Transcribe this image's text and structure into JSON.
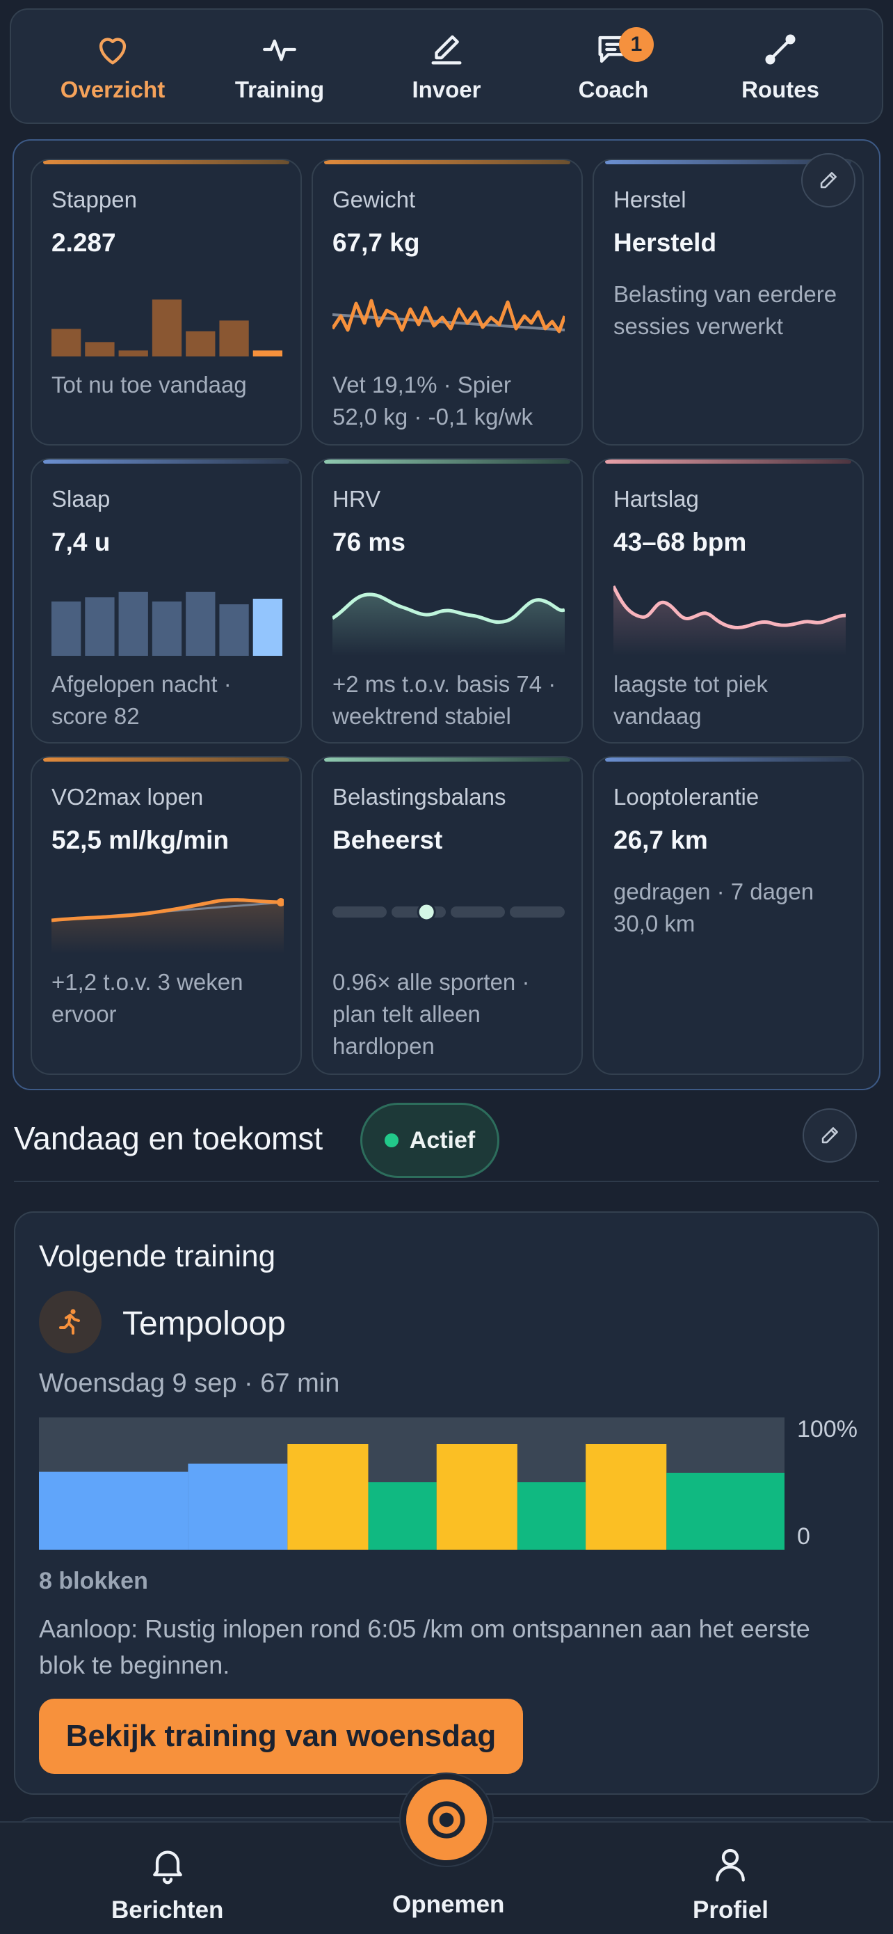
{
  "nav": {
    "items": [
      {
        "label": "Overzicht",
        "icon": "heart-icon",
        "active": true
      },
      {
        "label": "Training",
        "icon": "activity-icon",
        "active": false
      },
      {
        "label": "Invoer",
        "icon": "pencil-icon",
        "active": false
      },
      {
        "label": "Coach",
        "icon": "chat-icon",
        "active": false,
        "badge": "1"
      },
      {
        "label": "Routes",
        "icon": "route-icon",
        "active": false
      }
    ]
  },
  "metrics": [
    {
      "title": "Stappen",
      "value": "2.287",
      "desc": "Tot nu toe vandaag",
      "accent": "#e08a3c"
    },
    {
      "title": "Gewicht",
      "value": "67,7 kg",
      "desc": "Vet 19,1% · Spier 52,0 kg · -0,1 kg/wk",
      "accent": "#e08a3c"
    },
    {
      "title": "Herstel",
      "value": "Hersteld",
      "desc": "Belasting van eerdere sessies verwerkt",
      "accent": "#6b8fd0"
    },
    {
      "title": "Slaap",
      "value": "7,4 u",
      "desc": "Afgelopen nacht · score 82",
      "accent": "#6b8fd0"
    },
    {
      "title": "HRV",
      "value": "76 ms",
      "desc": "+2 ms t.o.v. basis 74 · weektrend stabiel",
      "accent": "#8fc9b0"
    },
    {
      "title": "Hartslag",
      "value": "43–68 bpm",
      "desc": "laagste tot piek vandaag",
      "accent": "#e8a0a8"
    },
    {
      "title": "VO2max lopen",
      "value": "52,5 ml/kg/min",
      "desc": "+1,2 t.o.v. 3 weken ervoor",
      "accent": "#e08a3c"
    },
    {
      "title": "Belastingsbalans",
      "value": "Beheerst",
      "desc": "0.96× alle sporten · plan telt alleen hardlopen",
      "accent": "#8fc9b0"
    },
    {
      "title": "Looptolerantie",
      "value": "26,7 km",
      "desc": "gedragen · 7 dagen 30,0 km",
      "accent": "#6b8fd0"
    }
  ],
  "section": {
    "title": "Vandaag en toekomst",
    "status": "Actief"
  },
  "training": {
    "heading": "Volgende training",
    "name": "Tempoloop",
    "date": "Woensdag 9 sep · 67 min",
    "axis_top": "100%",
    "axis_bottom": "0",
    "block_count": "8 blokken",
    "description": "Aanloop: Rustig inlopen rond 6:05 /km om ontspannen aan het eerste blok te beginnen.",
    "cta": "Bekijk training van woensdag",
    "blocks": [
      {
        "type": "warmup",
        "intensity": 0.59,
        "duration": 12,
        "color": "#60a5fa"
      },
      {
        "type": "warmup",
        "intensity": 0.65,
        "duration": 8,
        "color": "#60a5fa"
      },
      {
        "type": "tempo",
        "intensity": 0.8,
        "duration": 6.5,
        "color": "#fbbf24"
      },
      {
        "type": "recovery",
        "intensity": 0.51,
        "duration": 5.5,
        "color": "#10b981"
      },
      {
        "type": "tempo",
        "intensity": 0.8,
        "duration": 6.5,
        "color": "#fbbf24"
      },
      {
        "type": "recovery",
        "intensity": 0.51,
        "duration": 5.5,
        "color": "#10b981"
      },
      {
        "type": "tempo",
        "intensity": 0.8,
        "duration": 6.5,
        "color": "#fbbf24"
      },
      {
        "type": "cooldown",
        "intensity": 0.58,
        "duration": 9.5,
        "color": "#10b981"
      }
    ]
  },
  "bottombar": {
    "left": "Berichten",
    "center": "Opnemen",
    "right": "Profiel"
  },
  "viz": {
    "steps_bars": [
      0.46,
      0.24,
      0.1,
      0.95,
      0.42,
      0.6,
      0.1
    ],
    "sleep_bars": [
      0.78,
      0.84,
      0.92,
      0.78,
      0.92,
      0.74,
      0.82
    ],
    "load_balance_position": 0.4
  }
}
